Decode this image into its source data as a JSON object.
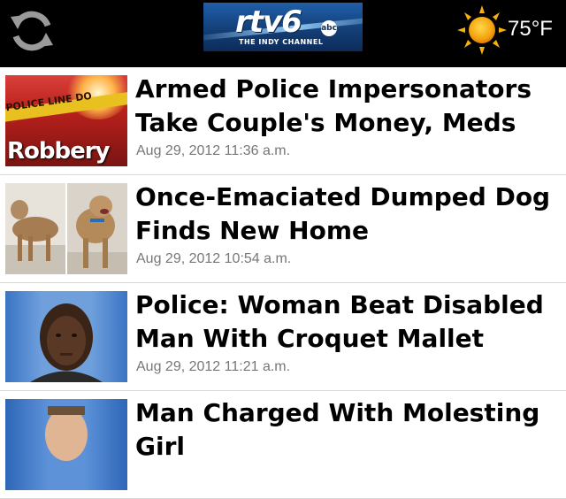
{
  "header": {
    "logo_text": "rtv6",
    "logo_network": "abc",
    "logo_channel": "THE INDY CHANNEL",
    "weather": {
      "icon": "sun-icon",
      "temperature": "75°F"
    },
    "refresh_icon": "refresh-icon"
  },
  "articles": [
    {
      "headline": "Armed Police Impersonators Take Couple's Money, Meds",
      "date": "Aug 29, 2012 11:36 a.m.",
      "thumb_text": "Robbery",
      "thumb_tape_text": "POLICE LINE  DO"
    },
    {
      "headline": "Once-Emaciated Dumped Dog Finds New Home",
      "date": "Aug 29, 2012 10:54 a.m."
    },
    {
      "headline": "Police: Woman Beat Disabled Man With Croquet Mallet",
      "date": "Aug 29, 2012 11:21 a.m."
    },
    {
      "headline": "Man Charged With Molesting Girl",
      "date": ""
    }
  ],
  "colors": {
    "header_bg": "#000000",
    "accent_blue": "#1f5fa8",
    "date_gray": "#777777",
    "divider": "#d8d8d8"
  }
}
